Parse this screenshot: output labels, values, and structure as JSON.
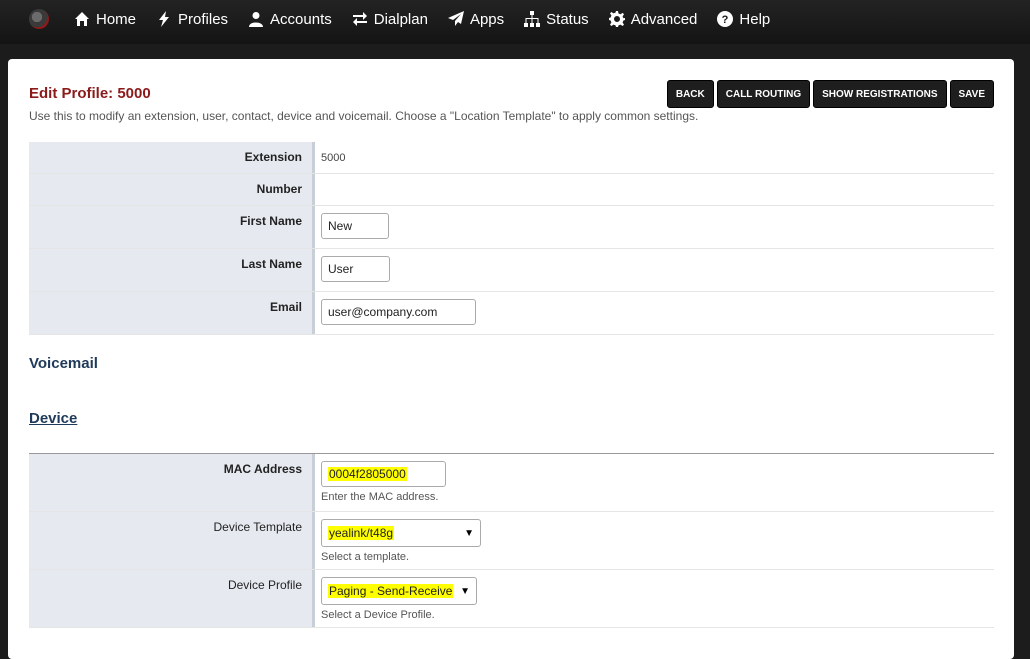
{
  "nav": {
    "items": [
      {
        "label": "Home",
        "icon": "home-icon"
      },
      {
        "label": "Profiles",
        "icon": "bolt-icon"
      },
      {
        "label": "Accounts",
        "icon": "user-icon"
      },
      {
        "label": "Dialplan",
        "icon": "exchange-icon"
      },
      {
        "label": "Apps",
        "icon": "paper-plane-icon"
      },
      {
        "label": "Status",
        "icon": "sitemap-icon"
      },
      {
        "label": "Advanced",
        "icon": "gear-icon"
      },
      {
        "label": "Help",
        "icon": "question-icon"
      }
    ]
  },
  "page": {
    "title": "Edit Profile: 5000",
    "description": "Use this to modify an extension, user, contact, device and voicemail. Choose a \"Location Template\" to apply common settings."
  },
  "actions": {
    "back": "BACK",
    "call_routing": "CALL ROUTING",
    "show_registrations": "SHOW REGISTRATIONS",
    "save": "SAVE"
  },
  "profile": {
    "extension_label": "Extension",
    "extension_value": "5000",
    "number_label": "Number",
    "first_name_label": "First Name",
    "first_name_value": "New",
    "last_name_label": "Last Name",
    "last_name_value": "User",
    "email_label": "Email",
    "email_value": "user@company.com"
  },
  "sections": {
    "voicemail": "Voicemail",
    "device": "Device"
  },
  "device": {
    "mac_label": "MAC Address",
    "mac_value": "0004f2805000",
    "mac_hint": "Enter the MAC address.",
    "template_label": "Device Template",
    "template_value": "yealink/t48g",
    "template_hint": "Select a template.",
    "profile_label": "Device Profile",
    "profile_value": "Paging - Send-Receive",
    "profile_hint": "Select a Device Profile."
  },
  "colors": {
    "title": "#8b1a1a",
    "section": "#1f3a5a",
    "highlight": "#ffff00",
    "label_bg": "#e6eaf0"
  }
}
